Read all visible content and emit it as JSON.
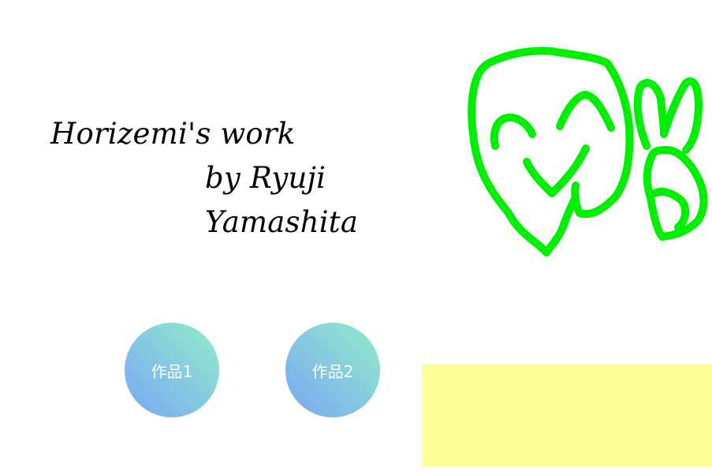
{
  "header": {
    "title": "Horizemi's work",
    "byline_1": "by Ryuji",
    "byline_2": "Yamashita"
  },
  "buttons": [
    {
      "label": "作品1"
    },
    {
      "label": "作品2"
    }
  ],
  "colors": {
    "drawing_stroke": "#00ee00",
    "button_gradient_start": "#7aa7f4",
    "button_gradient_end": "#8ff0c6",
    "yellow_panel": "#ffff99"
  },
  "icons": {
    "drawing": "hand-drawn-face-doodle"
  }
}
